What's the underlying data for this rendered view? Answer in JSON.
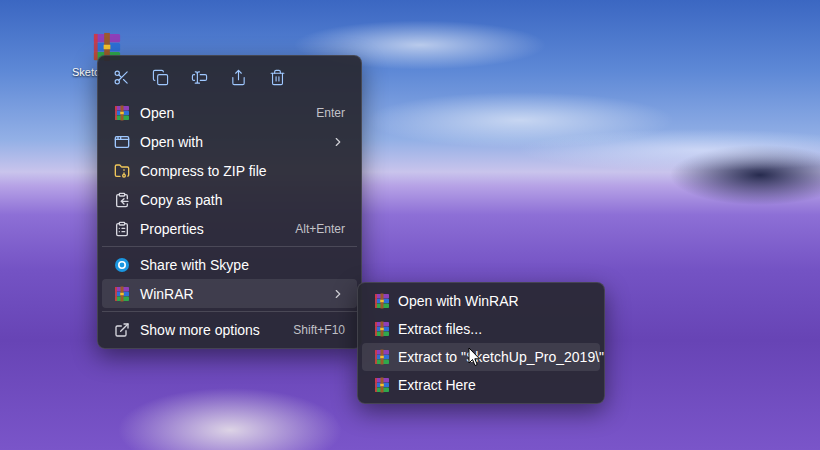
{
  "desktop": {
    "icons": [
      {
        "label": "Sketc"
      }
    ]
  },
  "context_menu": {
    "items": [
      {
        "kind": "item",
        "label": "Open",
        "shortcut": "Enter",
        "has_submenu": false,
        "selected": false
      },
      {
        "kind": "item",
        "label": "Open with",
        "has_submenu": true,
        "selected": false
      },
      {
        "kind": "item",
        "label": "Compress to ZIP file",
        "has_submenu": false,
        "selected": false
      },
      {
        "kind": "item",
        "label": "Copy as path",
        "has_submenu": false,
        "selected": false
      },
      {
        "kind": "item",
        "label": "Properties",
        "shortcut": "Alt+Enter",
        "has_submenu": false,
        "selected": false
      },
      {
        "kind": "separator"
      },
      {
        "kind": "item",
        "label": "Share with Skype",
        "has_submenu": false,
        "selected": false
      },
      {
        "kind": "item",
        "label": "WinRAR",
        "has_submenu": true,
        "selected": true
      },
      {
        "kind": "separator"
      },
      {
        "kind": "item",
        "label": "Show more options",
        "shortcut": "Shift+F10",
        "has_submenu": false,
        "selected": false
      }
    ]
  },
  "submenu": {
    "items": [
      {
        "label": "Open with WinRAR",
        "selected": false
      },
      {
        "label": "Extract files...",
        "selected": false
      },
      {
        "label": "Extract to \"SketchUp_Pro_2019\\\"",
        "selected": true
      },
      {
        "label": "Extract Here",
        "selected": false
      }
    ]
  }
}
